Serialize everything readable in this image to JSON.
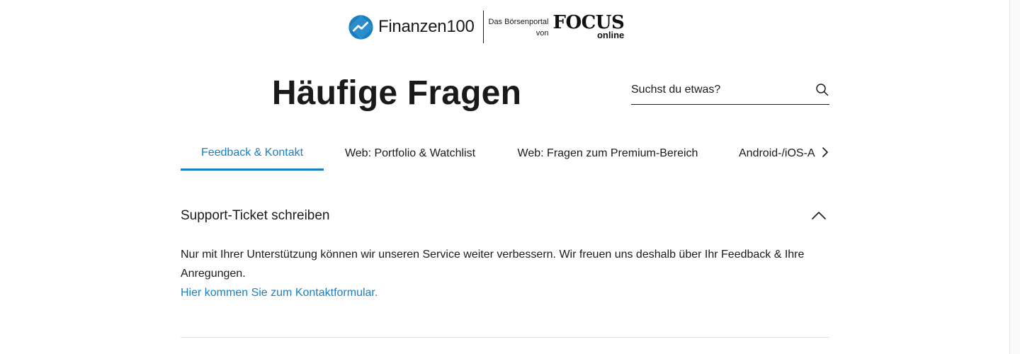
{
  "header": {
    "logo_brand_light": "Finanzen",
    "logo_brand_bold": "100",
    "tagline_line1": "Das Börsenportal",
    "tagline_line2": "von",
    "partner_name": "FOCUS",
    "partner_sub": "online"
  },
  "page": {
    "title": "Häufige Fragen"
  },
  "search": {
    "placeholder": "Suchst du etwas?",
    "icon": "search-icon"
  },
  "tabs": [
    {
      "label": "Feedback & Kontakt",
      "active": true
    },
    {
      "label": "Web: Portfolio & Watchlist",
      "active": false
    },
    {
      "label": "Web: Fragen zum Premium-Bereich",
      "active": false
    },
    {
      "label": "Android-/iOS-A",
      "active": false
    }
  ],
  "accordion": {
    "title": "Support-Ticket schreiben",
    "expanded": true,
    "body_text": "Nur mit Ihrer Unterstützung können wir unseren Service weiter verbessern. Wir freuen uns deshalb über Ihr Feedback & Ihre Anregungen.",
    "link_text": "Hier kommen Sie zum Kontaktformular."
  },
  "colors": {
    "accent": "#1a7fc1",
    "text": "#1a1a1a",
    "divider": "#e5e5e5"
  }
}
